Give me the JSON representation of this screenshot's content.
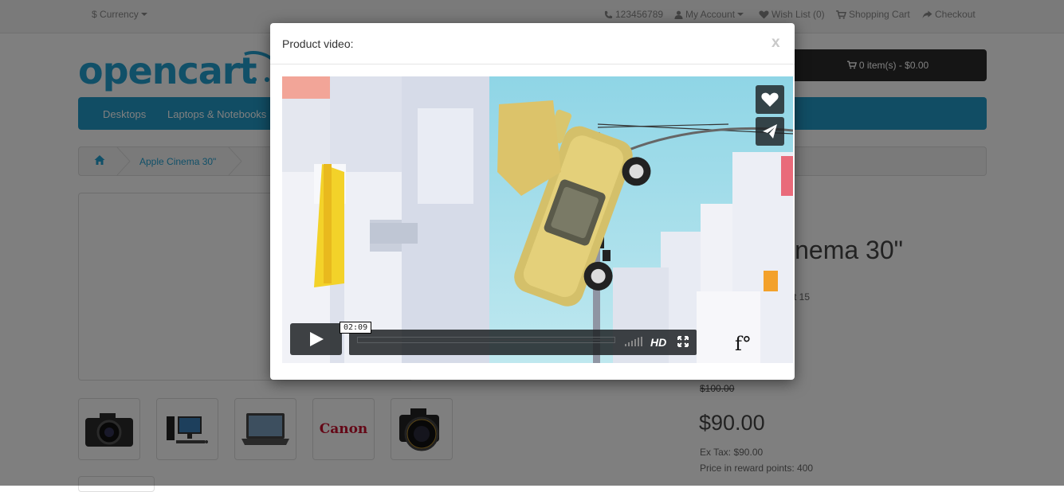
{
  "topbar": {
    "currency_label": "Currency",
    "currency_icon": "dollar-sign",
    "phone": "123456789",
    "my_account": "My Account",
    "wish_list": "Wish List (0)",
    "shopping_cart": "Shopping Cart",
    "checkout": "Checkout"
  },
  "header": {
    "logo_text": "opencart",
    "cart_button": "0 item(s) - $0.00"
  },
  "menu": {
    "items": [
      "Desktops",
      "Laptops & Notebooks"
    ]
  },
  "breadcrumb": {
    "home_icon": "home-icon",
    "current": "Apple Cinema 30\""
  },
  "product": {
    "title": "inema 30\"",
    "code_partial": "ct 15",
    "old_price": "$100.00",
    "price": "$90.00",
    "ex_tax": "Ex Tax: $90.00",
    "reward_points": "Price in reward points: 400",
    "thumbnails": [
      "camera",
      "desktop-computer",
      "laptop",
      "canon-logo",
      "dslr-camera"
    ],
    "thumbnail_logo_text": "Canon"
  },
  "modal": {
    "title": "Product video:",
    "close_label": "x",
    "video": {
      "current_time": "02:09",
      "hd_label": "HD",
      "watermark": "f°"
    }
  },
  "colors": {
    "brand_blue": "#229ac8",
    "link_blue": "#23a1d1",
    "overlay": "rgba(0,0,0,0.5)"
  }
}
